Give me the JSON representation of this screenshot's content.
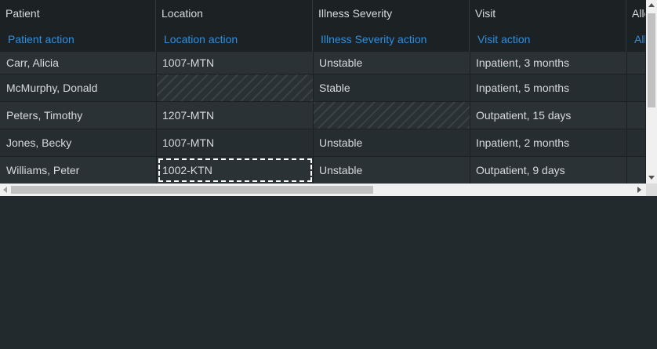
{
  "columns": [
    {
      "title": "Patient",
      "action": "Patient action"
    },
    {
      "title": "Location",
      "action": "Location action"
    },
    {
      "title": "Illness Severity",
      "action": "Illness Severity action"
    },
    {
      "title": "Visit",
      "action": "Visit action"
    },
    {
      "title": "Alle",
      "action": "All"
    }
  ],
  "rows": [
    {
      "patient": "Carr, Alicia",
      "location": "1007-MTN",
      "severity": "Unstable",
      "visit": "Inpatient, 3 months"
    },
    {
      "patient": "McMurphy, Donald",
      "location": "",
      "severity": "Stable",
      "visit": "Inpatient, 5 months"
    },
    {
      "patient": "Peters, Timothy",
      "location": "1207-MTN",
      "severity": "",
      "visit": "Outpatient, 15 days"
    },
    {
      "patient": "Jones, Becky",
      "location": "1007-MTN",
      "severity": "Unstable",
      "visit": "Inpatient, 2 months"
    },
    {
      "patient": "Williams, Peter",
      "location": "1002-KTN",
      "severity": "Unstable",
      "visit": "Outpatient, 9 days"
    }
  ],
  "colors": {
    "background": "#232a2d",
    "header": "#1c2124",
    "action_link": "#2f8fe0"
  },
  "icons": {
    "scroll_up": "triangle-up-icon",
    "scroll_down": "triangle-down-icon",
    "scroll_left": "triangle-left-icon",
    "scroll_right": "triangle-right-icon"
  }
}
